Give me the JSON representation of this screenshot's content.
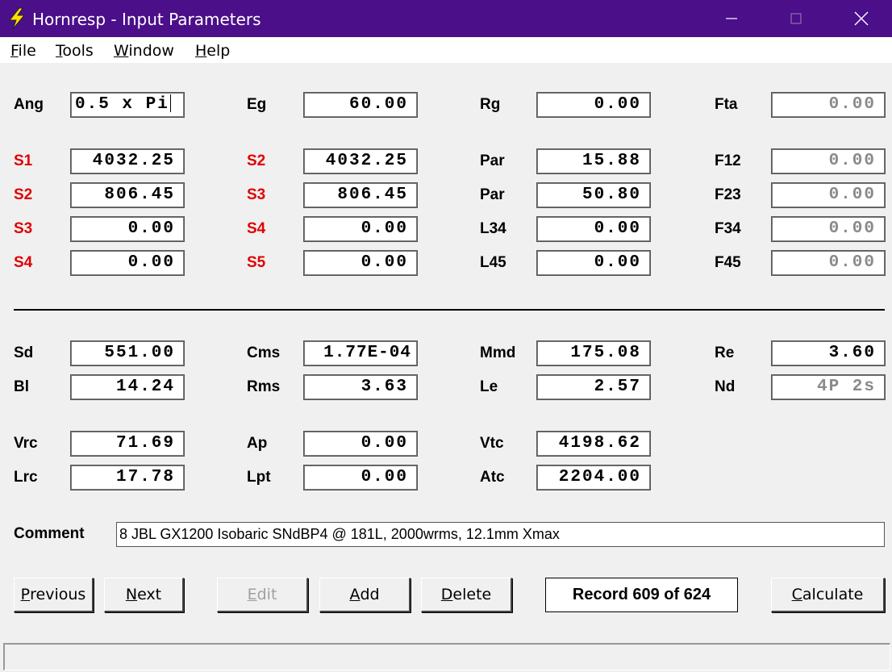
{
  "window": {
    "title": "Hornresp - Input Parameters",
    "accent_color": "#4b0f8a",
    "icon": "lightning-icon",
    "controls": {
      "minimize": "minimize-icon",
      "maximize": "maximize-icon",
      "close": "close-icon"
    }
  },
  "menu": [
    {
      "mnemonic": "F",
      "rest": "ile"
    },
    {
      "mnemonic": "T",
      "rest": "ools"
    },
    {
      "mnemonic": "W",
      "rest": "indow"
    },
    {
      "mnemonic": "H",
      "rest": "elp"
    }
  ],
  "fields": {
    "ang": {
      "label": "Ang",
      "value": "0.5 x Pi"
    },
    "eg": {
      "label": "Eg",
      "value": "60.00"
    },
    "rg": {
      "label": "Rg",
      "value": "0.00"
    },
    "fta": {
      "label": "Fta",
      "value": "0.00"
    },
    "row1": [
      {
        "label": "S1",
        "value": "4032.25"
      },
      {
        "label": "S2",
        "value": "4032.25"
      },
      {
        "label": "Par",
        "value": "15.88"
      },
      {
        "label": "F12",
        "value": "0.00"
      }
    ],
    "row2": [
      {
        "label": "S2",
        "value": "806.45"
      },
      {
        "label": "S3",
        "value": "806.45"
      },
      {
        "label": "Par",
        "value": "50.80"
      },
      {
        "label": "F23",
        "value": "0.00"
      }
    ],
    "row3": [
      {
        "label": "S3",
        "value": "0.00"
      },
      {
        "label": "S4",
        "value": "0.00"
      },
      {
        "label": "L34",
        "value": "0.00"
      },
      {
        "label": "F34",
        "value": "0.00"
      }
    ],
    "row4": [
      {
        "label": "S4",
        "value": "0.00"
      },
      {
        "label": "S5",
        "value": "0.00"
      },
      {
        "label": "L45",
        "value": "0.00"
      },
      {
        "label": "F45",
        "value": "0.00"
      }
    ],
    "driver1": [
      {
        "label": "Sd",
        "value": "551.00"
      },
      {
        "label": "Cms",
        "value": "1.77E-04"
      },
      {
        "label": "Mmd",
        "value": "175.08"
      },
      {
        "label": "Re",
        "value": "3.60"
      }
    ],
    "driver2": [
      {
        "label": "Bl",
        "value": "14.24"
      },
      {
        "label": "Rms",
        "value": "3.63"
      },
      {
        "label": "Le",
        "value": "2.57"
      },
      {
        "label": "Nd",
        "value": "4P 2s"
      }
    ],
    "chamber1": [
      {
        "label": "Vrc",
        "value": "71.69"
      },
      {
        "label": "Ap",
        "value": "0.00"
      },
      {
        "label": "Vtc",
        "value": "4198.62"
      }
    ],
    "chamber2": [
      {
        "label": "Lrc",
        "value": "17.78"
      },
      {
        "label": "Lpt",
        "value": "0.00"
      },
      {
        "label": "Atc",
        "value": "2204.00"
      }
    ]
  },
  "comment": {
    "label": "Comment",
    "value": "8 JBL GX1200 Isobaric SNdBP4 @ 181L, 2000wrms, 12.1mm Xmax"
  },
  "buttons": {
    "previous": {
      "mnemonic": "P",
      "rest": "revious"
    },
    "next": {
      "mnemonic": "N",
      "rest": "ext"
    },
    "edit": {
      "mnemonic": "E",
      "rest": "dit"
    },
    "add": {
      "mnemonic": "A",
      "rest": "dd"
    },
    "delete": {
      "mnemonic": "D",
      "rest": "elete"
    },
    "calculate": {
      "mnemonic": "C",
      "rest": "alculate"
    }
  },
  "record": "Record 609 of 624",
  "colors": {
    "segment_label": "#e00000",
    "disabled_text": "#8a8a8a"
  }
}
